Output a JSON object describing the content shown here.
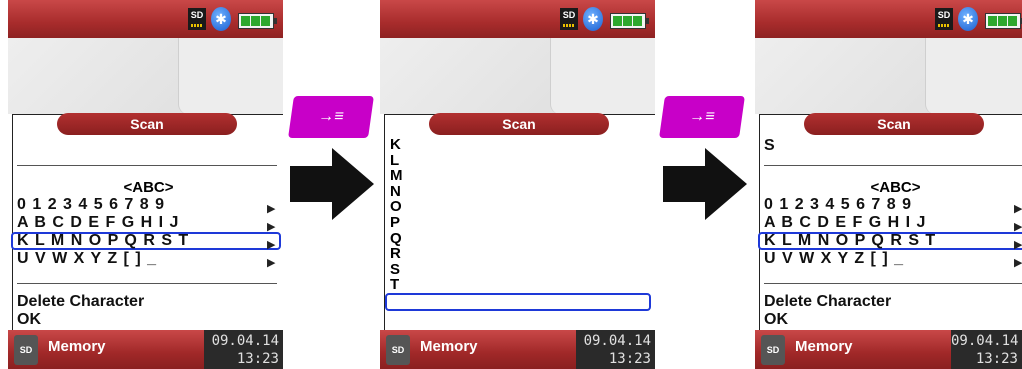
{
  "status_icons": [
    "sd-card-icon",
    "bluetooth-icon",
    "battery-icon"
  ],
  "status": {
    "sd_label": "SD"
  },
  "screen1": {
    "title": "Scan",
    "abc": "<ABC>",
    "rows": [
      "0 1 2 3 4 5 6 7 8 9",
      "A B C D E F G H I J",
      "K L M N O P Q R S T",
      "U V W X Y Z [ ] _"
    ],
    "delete": "Delete Character",
    "ok": "OK"
  },
  "screen2": {
    "title": "Scan",
    "letters": [
      "K",
      "L",
      "M",
      "N",
      "O",
      "P",
      "Q",
      "R",
      "S",
      "T"
    ],
    "selected": "S"
  },
  "screen3": {
    "title": "Scan",
    "entry": "S",
    "abc": "<ABC>",
    "rows": [
      "0 1 2 3 4 5 6 7 8 9",
      "A B C D E F G H I J",
      "K L M N O P Q R S T",
      "U V W X Y Z [ ] _"
    ],
    "delete": "Delete Character",
    "ok": "OK"
  },
  "footer": {
    "label": "Memory",
    "date": "09.04.14",
    "time": "13:23",
    "sd_label": "SD"
  },
  "key_label": "→≡",
  "colors": {
    "accent_red": "#a82c2c",
    "key_magenta": "#c800c8",
    "highlight_blue": "#1e39d8"
  }
}
